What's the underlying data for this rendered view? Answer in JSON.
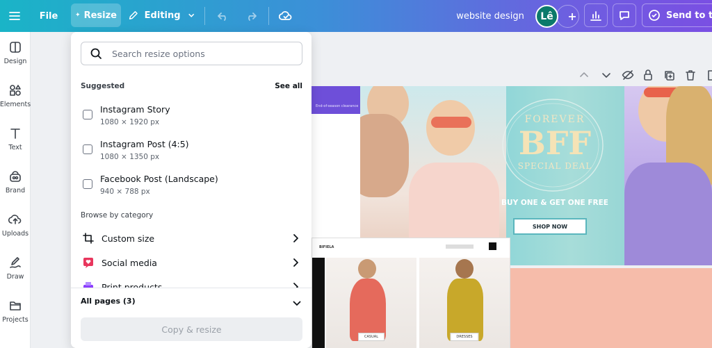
{
  "topbar": {
    "file_label": "File",
    "resize_label": "Resize",
    "editing_label": "Editing",
    "doc_title": "website design",
    "avatar_initials": "Lê",
    "send_label": "Send to tea"
  },
  "sidebar": {
    "items": [
      {
        "label": "Design",
        "icon": "design-icon"
      },
      {
        "label": "Elements",
        "icon": "elements-icon"
      },
      {
        "label": "Text",
        "icon": "text-icon"
      },
      {
        "label": "Brand",
        "icon": "brand-icon"
      },
      {
        "label": "Uploads",
        "icon": "uploads-icon"
      },
      {
        "label": "Draw",
        "icon": "draw-icon"
      },
      {
        "label": "Projects",
        "icon": "projects-icon"
      }
    ]
  },
  "resize_panel": {
    "search_placeholder": "Search resize options",
    "suggested_label": "Suggested",
    "see_all_label": "See all",
    "options": [
      {
        "title": "Instagram Story",
        "size": "1080 × 1920 px"
      },
      {
        "title": "Instagram Post (4:5)",
        "size": "1080 × 1350 px"
      },
      {
        "title": "Facebook Post (Landscape)",
        "size": "940 × 788 px"
      }
    ],
    "browse_label": "Browse by category",
    "categories": [
      {
        "label": "Custom size",
        "icon": "custom-size-icon"
      },
      {
        "label": "Social media",
        "icon": "social-media-icon"
      },
      {
        "label": "Print products",
        "icon": "print-products-icon"
      }
    ],
    "all_pages_label": "All pages (3)",
    "copy_resize_label": "Copy & resize"
  },
  "canvas": {
    "banner": {
      "forever": "FOREVER",
      "bff": "BFF",
      "special_deal": "SPECIAL DEAL",
      "offer": "BUY ONE & GET ONE FREE",
      "shop_now": "SHOP NOW"
    },
    "strip_text": "End-of-season clearance",
    "product_page": {
      "brand": "BIFIELA",
      "tags": [
        "CASUAL",
        "DRESSES"
      ]
    }
  },
  "colors": {
    "topbar_start": "#1ab4c7",
    "topbar_end": "#7a4fe3",
    "avatar": "#0c7a6b",
    "peach": "#f6bcaa",
    "purple": "#6e4fd9"
  }
}
